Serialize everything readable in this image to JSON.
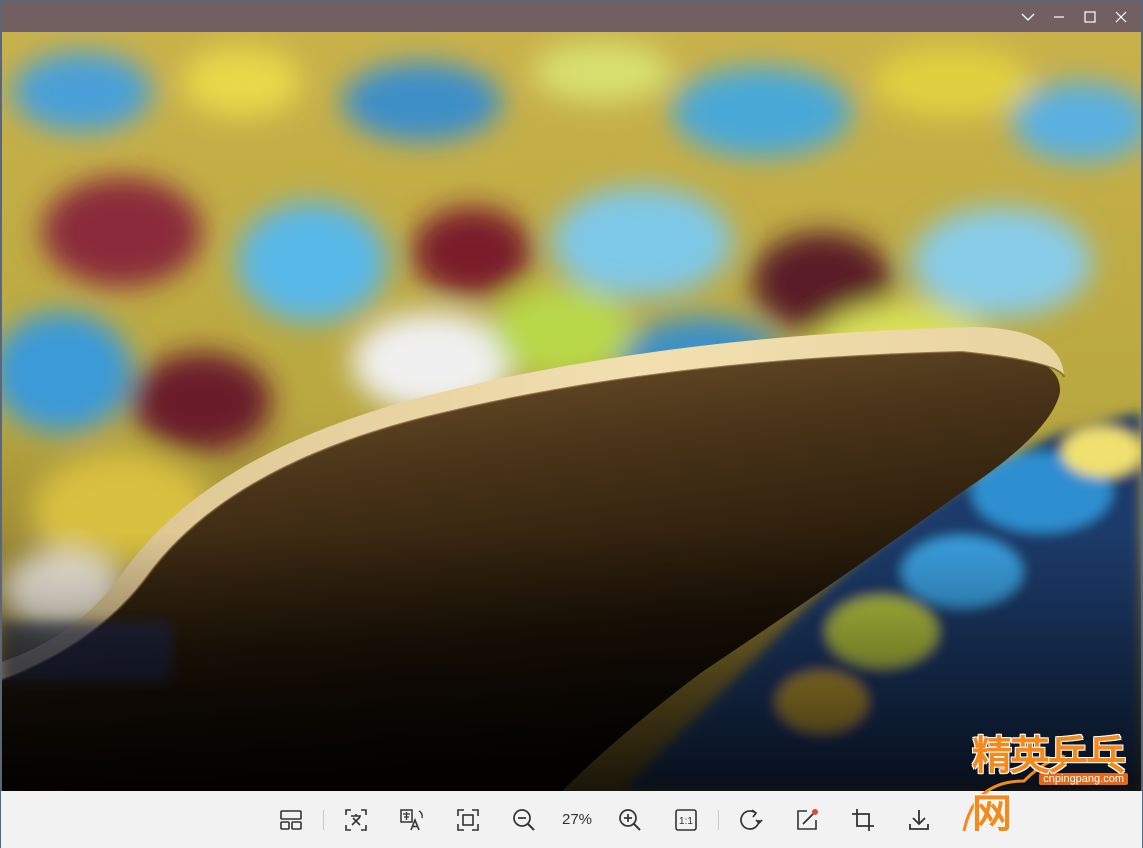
{
  "titlebar": {
    "controls": [
      "chevron-down-icon",
      "minimize-icon",
      "maximize-icon",
      "close-icon"
    ]
  },
  "toolbar": {
    "zoom_level": "27%",
    "actual_size_label": "1:1",
    "icons": [
      "thumbnail-layout-icon",
      "ocr-text-icon",
      "translate-icon",
      "fit-screen-icon",
      "zoom-out-icon",
      "zoom-in-icon",
      "actual-size-icon",
      "rotate-icon",
      "edit-icon",
      "crop-icon",
      "download-icon"
    ]
  },
  "watermark": {
    "site": "cnpingpang.com",
    "title": "精英乒乓网"
  },
  "colors": {
    "titlebar": "#715f62",
    "toolbar": "#f2f2f2",
    "accent_red": "#e0453a",
    "watermark_orange": "#f28a1e"
  }
}
